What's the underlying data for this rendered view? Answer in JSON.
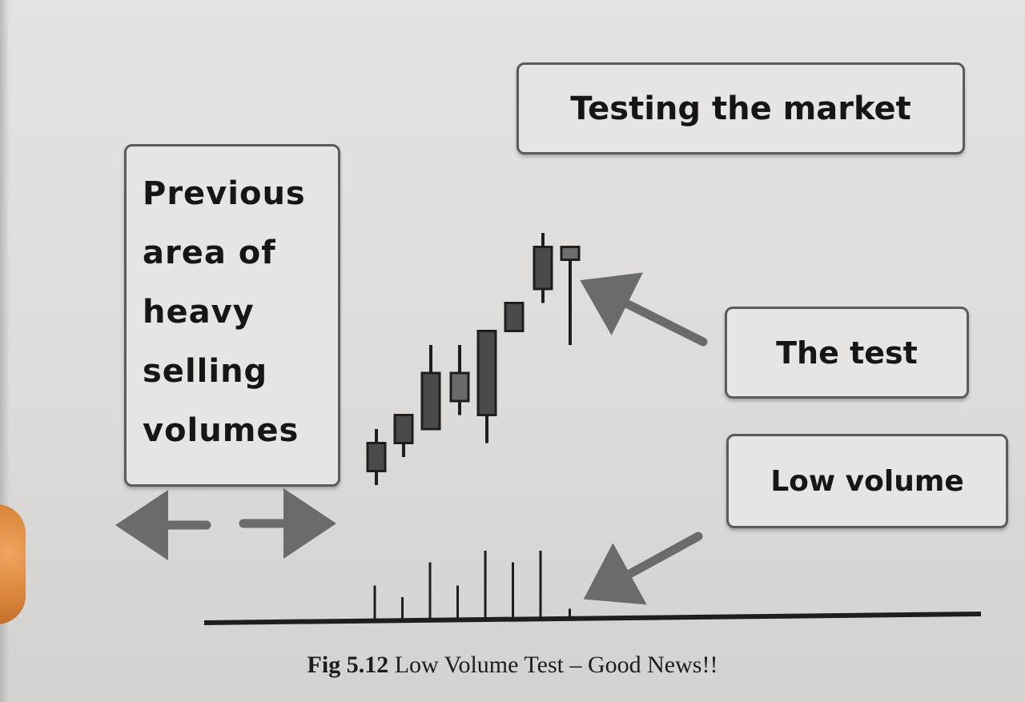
{
  "boxes": {
    "previous": "Previous\narea of\nheavy\nselling\nvolumes",
    "testing": "Testing the market",
    "test": "The test",
    "low_volume": "Low volume"
  },
  "caption": {
    "label": "Fig 5.12",
    "text": " Low Volume Test – Good News!!"
  },
  "colors": {
    "candle": "#4a4a4a",
    "test_candle": "#6e6e6e",
    "arrow": "#6b6b6b",
    "ink": "#161616"
  },
  "candles": [
    {
      "open": 1,
      "close": 3,
      "high": 4,
      "low": 0,
      "color": "dark"
    },
    {
      "open": 3,
      "close": 5,
      "high": 5,
      "low": 2,
      "color": "dark"
    },
    {
      "open": 4,
      "close": 8,
      "high": 10,
      "low": 4,
      "color": "dark"
    },
    {
      "open": 6,
      "close": 8,
      "high": 10,
      "low": 5,
      "color": "light"
    },
    {
      "open": 5,
      "close": 11,
      "high": 11,
      "low": 3,
      "color": "dark"
    },
    {
      "open": 11,
      "close": 13,
      "high": 13,
      "low": 11,
      "color": "dark"
    },
    {
      "open": 14,
      "close": 17,
      "high": 18,
      "low": 13,
      "color": "dark"
    },
    {
      "open": 16,
      "close": 17,
      "high": 17,
      "low": 10,
      "color": "test"
    }
  ],
  "volumes": [
    3,
    2,
    5,
    3,
    6,
    5,
    6,
    1
  ],
  "arrows": {
    "left": "left-arrow-icon",
    "right": "right-arrow-icon"
  }
}
